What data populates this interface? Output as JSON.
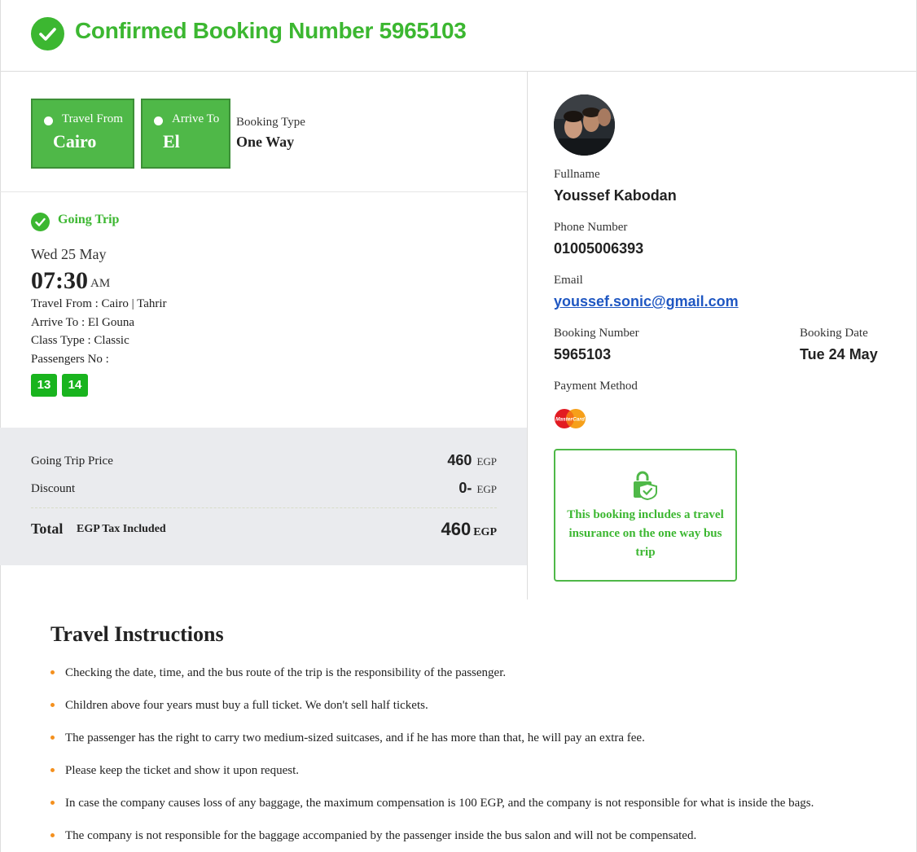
{
  "header": {
    "title": "Confirmed Booking Number 5965103"
  },
  "route": {
    "from_label": "Travel From",
    "from_city": "Cairo",
    "to_label": "Arrive To",
    "to_city": "El",
    "booking_type_label": "Booking Type",
    "booking_type_value": "One Way"
  },
  "going_trip": {
    "title": "Going Trip",
    "date": "Wed 25 May",
    "time": "07:30",
    "ampm": "AM",
    "travel_from": "Travel From : Cairo | Tahrir",
    "arrive_to": "Arrive To : El Gouna",
    "class_type": "Class Type : Classic",
    "passengers_label": "Passengers No :",
    "seats": [
      "13",
      "14"
    ]
  },
  "price": {
    "going_label": "Going Trip Price",
    "going_value": "460",
    "discount_label": "Discount",
    "discount_value": "0-",
    "currency": "EGP",
    "total_label": "Total",
    "total_note": "EGP Tax Included",
    "total_value": "460"
  },
  "passenger": {
    "fullname_label": "Fullname",
    "fullname": "Youssef Kabodan",
    "phone_label": "Phone Number",
    "phone": "01005006393",
    "email_label": "Email",
    "email": "youssef.sonic@gmail.com",
    "booking_number_label": "Booking Number",
    "booking_number": "5965103",
    "booking_date_label": "Booking Date",
    "booking_date": "Tue 24 May",
    "payment_label": "Payment Method",
    "payment_logo_text": "MasterCard"
  },
  "insurance": {
    "text": "This booking includes a travel insurance on the one way bus trip"
  },
  "instructions": {
    "title": "Travel Instructions",
    "items": [
      "Checking the date, time, and the bus route of the trip is the responsibility of the passenger.",
      "Children above four years must buy a full ticket. We don't sell half tickets.",
      "The passenger has the right to carry two medium-sized suitcases, and if he has more than that, he will pay an extra fee.",
      "Please keep the ticket and show it upon request.",
      "In case the company causes loss of any baggage, the maximum compensation is 100 EGP, and the company is not responsible for what is inside the bags.",
      "The company is not responsible for the baggage accompanied by the passenger inside the bus salon and will not be compensated."
    ]
  },
  "colors": {
    "accent_green": "#3cb731",
    "route_box_green": "#4fb848",
    "seat_green": "#19b41e",
    "link_blue": "#1f57c2",
    "bullet_orange": "#f4901e",
    "price_bg": "#eaebee"
  },
  "icons": {
    "header": "check-circle-icon",
    "trip": "check-circle-icon",
    "insurance": "shield-lock-icon",
    "payment": "mastercard-icon"
  }
}
